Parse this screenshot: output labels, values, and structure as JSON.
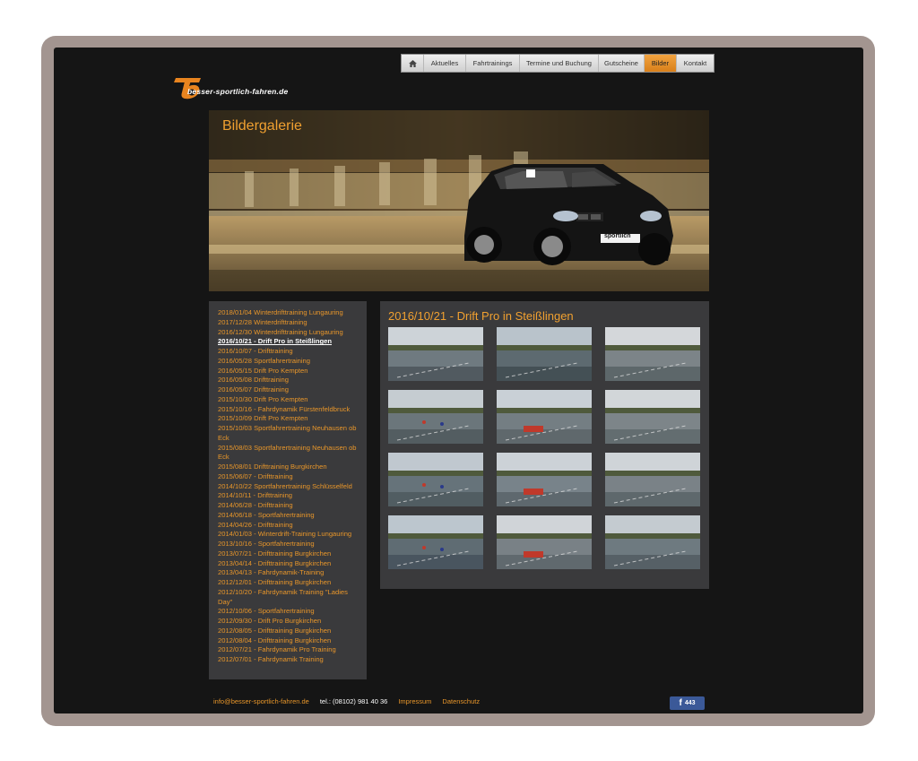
{
  "site": {
    "logo_text": "besser-sportlich-fahren.de"
  },
  "nav": {
    "items": [
      {
        "label": "",
        "icon": "home-icon"
      },
      {
        "label": "Aktuelles"
      },
      {
        "label": "Fahrtrainings"
      },
      {
        "label": "Termine und Buchung"
      },
      {
        "label": "Gutscheine"
      },
      {
        "label": "Bilder",
        "active": true
      },
      {
        "label": "Kontakt"
      }
    ],
    "accent": "#e8962a"
  },
  "hero": {
    "title": "Bildergalerie",
    "plate_text": "sportlich"
  },
  "sidebar": {
    "links": [
      "2018/01/04 Winterdrifttraining Lungauring",
      "2017/12/28 Winterdrifttraining",
      "2016/12/30 Winterdrifttraining Lungauring",
      "2016/10/21 - Drift Pro in Steißlingen",
      "2016/10/07 - Drifttraining",
      "2016/05/28 Sportfahrertraining",
      "2016/05/15 Drift Pro Kempten",
      "2016/05/08 Drifttraining",
      "2016/05/07 Drifttraining",
      "2015/10/30 Drift Pro Kempten",
      "2015/10/16 - Fahrdynamik Fürstenfeldbruck",
      "2015/10/09 Drift Pro Kempten",
      "2015/10/03 Sportfahrertraining Neuhausen ob Eck",
      "2015/08/03 Sportfahrertraining Neuhausen ob Eck",
      "2015/08/01 Drifttraining Burgkirchen",
      "2015/06/07 - Drifttraining",
      "2014/10/22 Sportfahrertraining Schlüsselfeld",
      "2014/10/11 - Drifttraining",
      "2014/06/28 - Drifttraining",
      "2014/06/18 - Sportfahrertraining",
      "2014/04/26 - Drifttraining",
      "2014/01/03 - Winterdrift-Training Lungauring",
      "2013/10/16 - Sportfahrertraining",
      "2013/07/21 - Drifttraining Burgkirchen",
      "2013/04/14 - Drifttraining Burgkirchen",
      "2013/04/13 - Fahrdynamik-Training",
      "2012/12/01 - Drifttraining Burgkirchen",
      "2012/10/20 - Fahrdynamik Training \"Ladies Day\"",
      "2012/10/06 - Sportfahrertraining",
      "2012/09/30 - Drift Pro Burgkirchen",
      "2012/08/05 - Drifttraining Burgkirchen",
      "2012/08/04 - Drifttraining Burgkirchen",
      "2012/07/21 - Fahrdynamik Pro Training",
      "2012/07/01 - Fahrdynamik Training"
    ],
    "current_index": 3
  },
  "gallery": {
    "title": "2016/10/21 - Drift Pro in Steißlingen",
    "thumbnail_count": 12
  },
  "footer": {
    "email": "info@besser-sportlich-fahren.de",
    "phone": "tel.: (08102) 981 40 36",
    "impressum": "Impressum",
    "datenschutz": "Datenschutz",
    "fb_count": "443"
  }
}
